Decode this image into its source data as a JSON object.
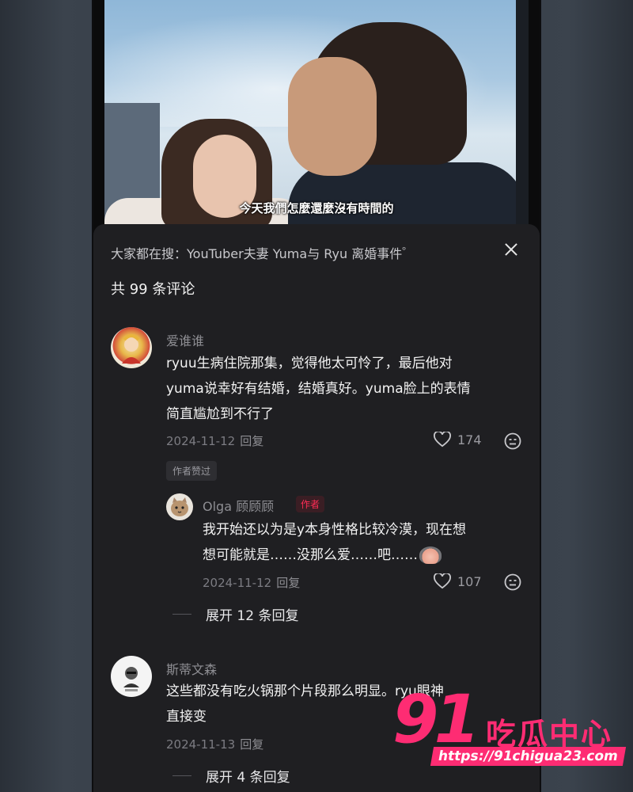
{
  "video": {
    "subtitle": "今天我們怎麼還麼沒有時間的"
  },
  "sheet": {
    "search_suggestion": "大家都在搜：YouTuber夫妻 Yuma与 Ryu 离婚事件",
    "comment_count": "共 99 条评论",
    "close_label": "close"
  },
  "comments": [
    {
      "username": "爱谁谁",
      "text_lines": [
        "ryuu生病住院那集，觉得他太可怜了，最后他对",
        "yuma说幸好有结婚，结婚真好。yuma脸上的表情",
        "简直尴尬到不行了"
      ],
      "date": "2024-11-12",
      "reply_label": "回复",
      "likes": "174",
      "author_liked_badge": "作者赞过",
      "reply": {
        "username": "Olga 顾顾顾",
        "author_tag": "作者",
        "text_lines": [
          "我开始还以为是y本身性格比较冷漠，现在想",
          "想可能就是……没那么爱……吧……"
        ],
        "date": "2024-11-12",
        "reply_label": "回复",
        "likes": "107"
      },
      "expand_label": "展开 12 条回复"
    },
    {
      "username": "斯蒂文森",
      "text_lines": [
        "这些都没有吃火锅那个片段那么明显",
        "直接变"
      ],
      "text_hidden_suffix": "。ryu眼神",
      "date": "2024-11-13",
      "reply_label": "回复",
      "expand_label": "展开 4 条回复"
    }
  ],
  "watermark": {
    "number": "91",
    "title": "吃瓜中心",
    "url": "https://91chigua23.com"
  },
  "colors": {
    "accent": "#fe2c55",
    "watermark": "#fe2c73",
    "sheet_bg": "#1f1f22"
  }
}
